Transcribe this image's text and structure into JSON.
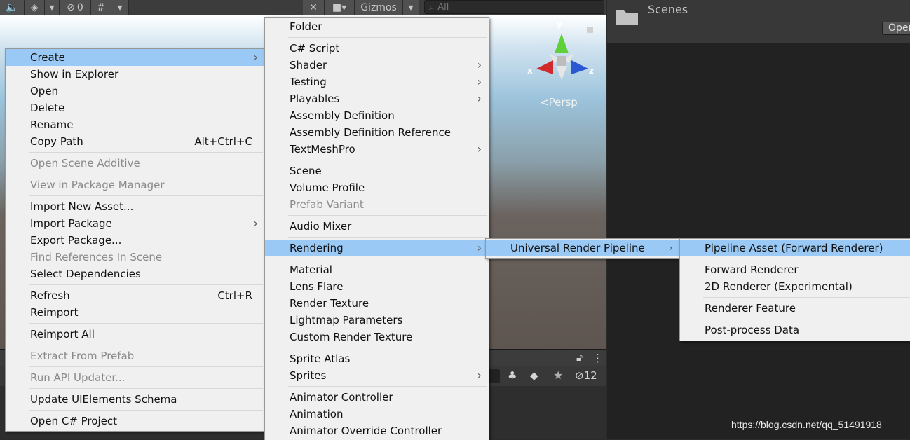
{
  "toolbar": {
    "visibility_count": "0",
    "gizmos_label": "Gizmos",
    "search_placeholder": "All"
  },
  "scene": {
    "persp_label": "<Persp",
    "axis_x": "x",
    "axis_y": "y",
    "axis_z": "z"
  },
  "project": {
    "folder_label": "Scenes",
    "open_label": "Open"
  },
  "hierarchy": {
    "hidden_count": "12"
  },
  "context_menu": {
    "items": [
      {
        "label": "Create",
        "shortcut": ""
      },
      {
        "label": "Show in Explorer",
        "shortcut": ""
      },
      {
        "label": "Open",
        "shortcut": ""
      },
      {
        "label": "Delete",
        "shortcut": ""
      },
      {
        "label": "Rename",
        "shortcut": ""
      },
      {
        "label": "Copy Path",
        "shortcut": "Alt+Ctrl+C"
      },
      {
        "label": "Open Scene Additive",
        "shortcut": ""
      },
      {
        "label": "View in Package Manager",
        "shortcut": ""
      },
      {
        "label": "Import New Asset...",
        "shortcut": ""
      },
      {
        "label": "Import Package",
        "shortcut": ""
      },
      {
        "label": "Export Package...",
        "shortcut": ""
      },
      {
        "label": "Find References In Scene",
        "shortcut": ""
      },
      {
        "label": "Select Dependencies",
        "shortcut": ""
      },
      {
        "label": "Refresh",
        "shortcut": "Ctrl+R"
      },
      {
        "label": "Reimport",
        "shortcut": ""
      },
      {
        "label": "Reimport All",
        "shortcut": ""
      },
      {
        "label": "Extract From Prefab",
        "shortcut": ""
      },
      {
        "label": "Run API Updater...",
        "shortcut": ""
      },
      {
        "label": "Update UIElements Schema",
        "shortcut": ""
      },
      {
        "label": "Open C# Project",
        "shortcut": ""
      }
    ]
  },
  "create_menu": {
    "items": [
      {
        "label": "Folder"
      },
      {
        "label": "C# Script"
      },
      {
        "label": "Shader"
      },
      {
        "label": "Testing"
      },
      {
        "label": "Playables"
      },
      {
        "label": "Assembly Definition"
      },
      {
        "label": "Assembly Definition Reference"
      },
      {
        "label": "TextMeshPro"
      },
      {
        "label": "Scene"
      },
      {
        "label": "Volume Profile"
      },
      {
        "label": "Prefab Variant"
      },
      {
        "label": "Audio Mixer"
      },
      {
        "label": "Rendering"
      },
      {
        "label": "Material"
      },
      {
        "label": "Lens Flare"
      },
      {
        "label": "Render Texture"
      },
      {
        "label": "Lightmap Parameters"
      },
      {
        "label": "Custom Render Texture"
      },
      {
        "label": "Sprite Atlas"
      },
      {
        "label": "Sprites"
      },
      {
        "label": "Animator Controller"
      },
      {
        "label": "Animation"
      },
      {
        "label": "Animator Override Controller"
      }
    ]
  },
  "rendering_menu": {
    "items": [
      {
        "label": "Universal Render Pipeline"
      }
    ]
  },
  "urp_menu": {
    "items": [
      {
        "label": "Pipeline Asset (Forward Renderer)"
      },
      {
        "label": "Forward Renderer"
      },
      {
        "label": "2D Renderer (Experimental)"
      },
      {
        "label": "Renderer Feature"
      },
      {
        "label": "Post-process Data"
      }
    ]
  },
  "watermark": "https://blog.csdn.net/qq_51491918"
}
